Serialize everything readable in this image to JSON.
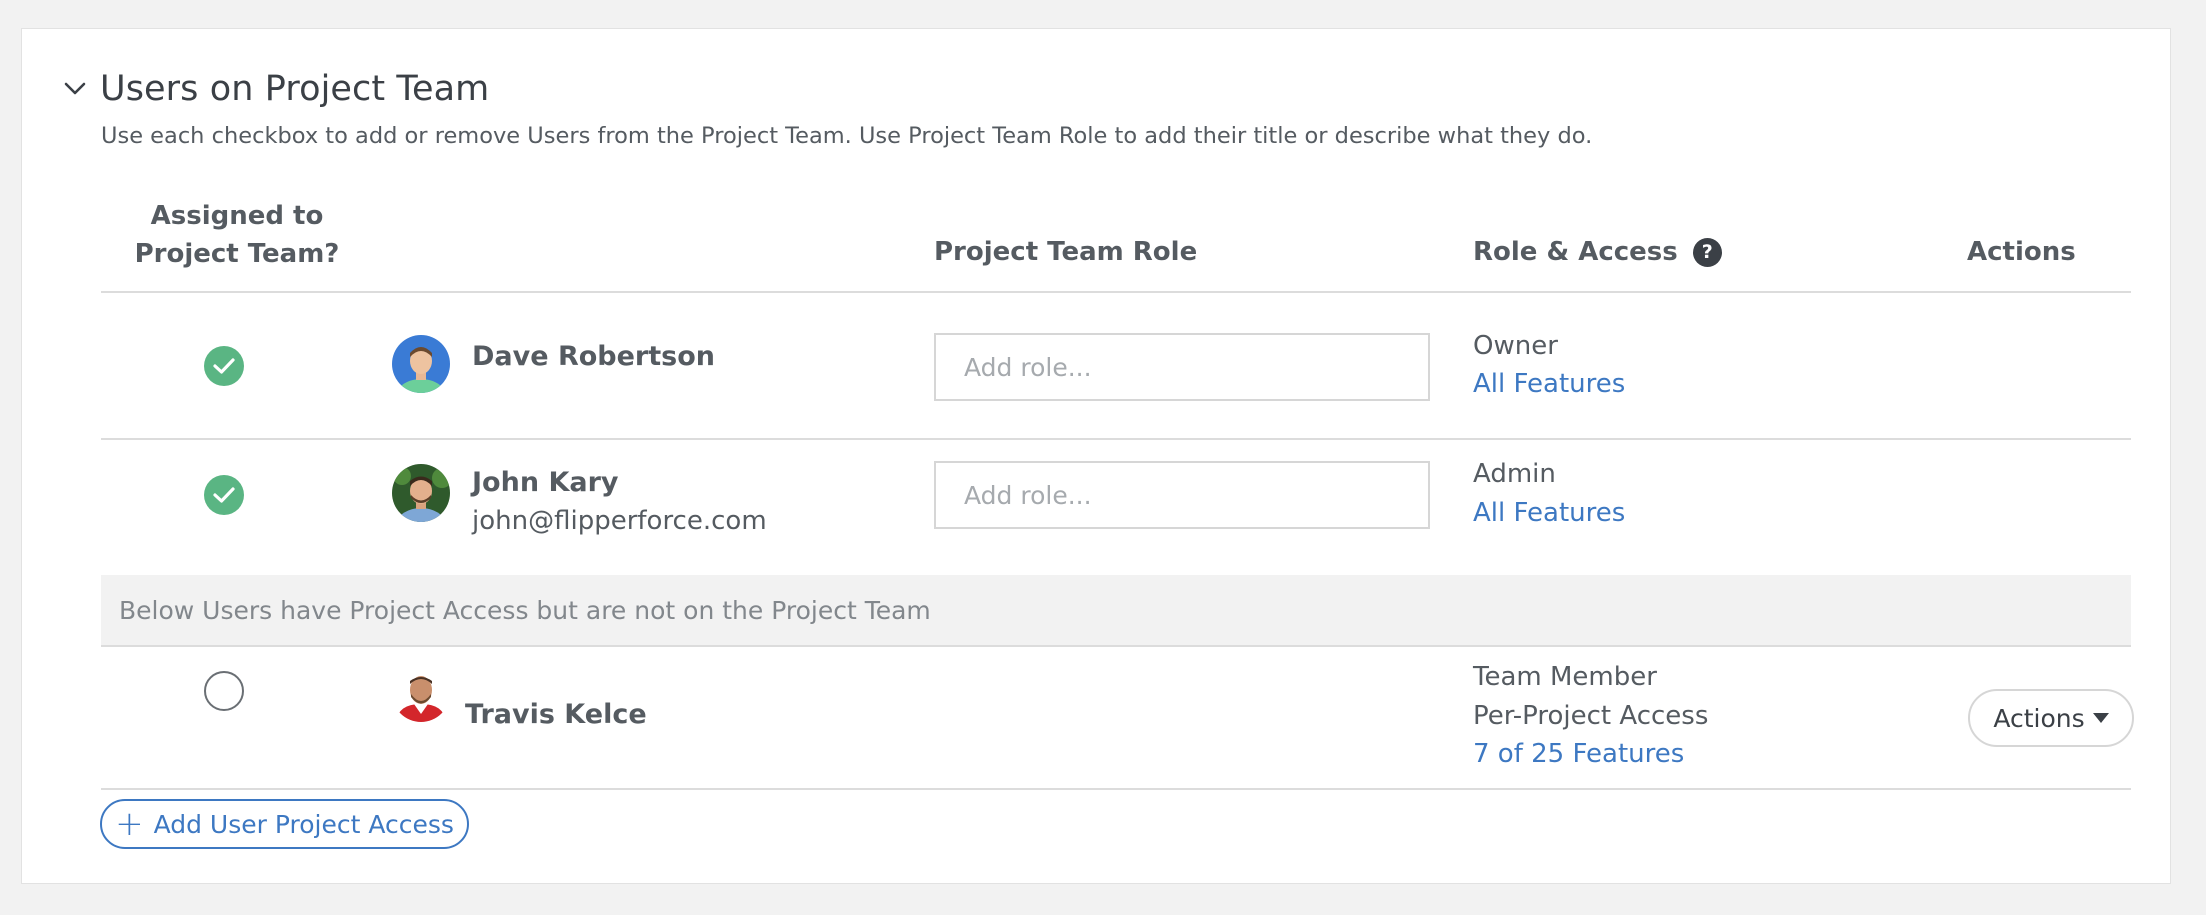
{
  "section": {
    "title": "Users on Project Team",
    "description": "Use each checkbox to add or remove Users from the Project Team. Use Project Team Role to add their title or describe what they do."
  },
  "columns": {
    "assigned": "Assigned to Project Team?",
    "role": "Project Team Role",
    "access": "Role & Access",
    "actions": "Actions"
  },
  "team_members": [
    {
      "name": "Dave Robertson",
      "email": "",
      "assigned": true,
      "role_placeholder": "Add role...",
      "access_role": "Owner",
      "features": "All Features"
    },
    {
      "name": "John Kary",
      "email": "john@flipperforce.com",
      "assigned": true,
      "role_placeholder": "Add role...",
      "access_role": "Admin",
      "features": "All Features"
    }
  ],
  "notice": "Below Users have Project Access but are not on the Project Team",
  "other_users": [
    {
      "name": "Travis Kelce",
      "assigned": false,
      "access_role": "Team Member",
      "access_type": "Per-Project Access",
      "features": "7 of 25 Features",
      "action_label": "Actions"
    }
  ],
  "add_button_label": "Add User Project Access",
  "help_icon_glyph": "?",
  "colors": {
    "accent": "#3d78c2",
    "check_green": "#5ab583",
    "text": "#555b61"
  }
}
